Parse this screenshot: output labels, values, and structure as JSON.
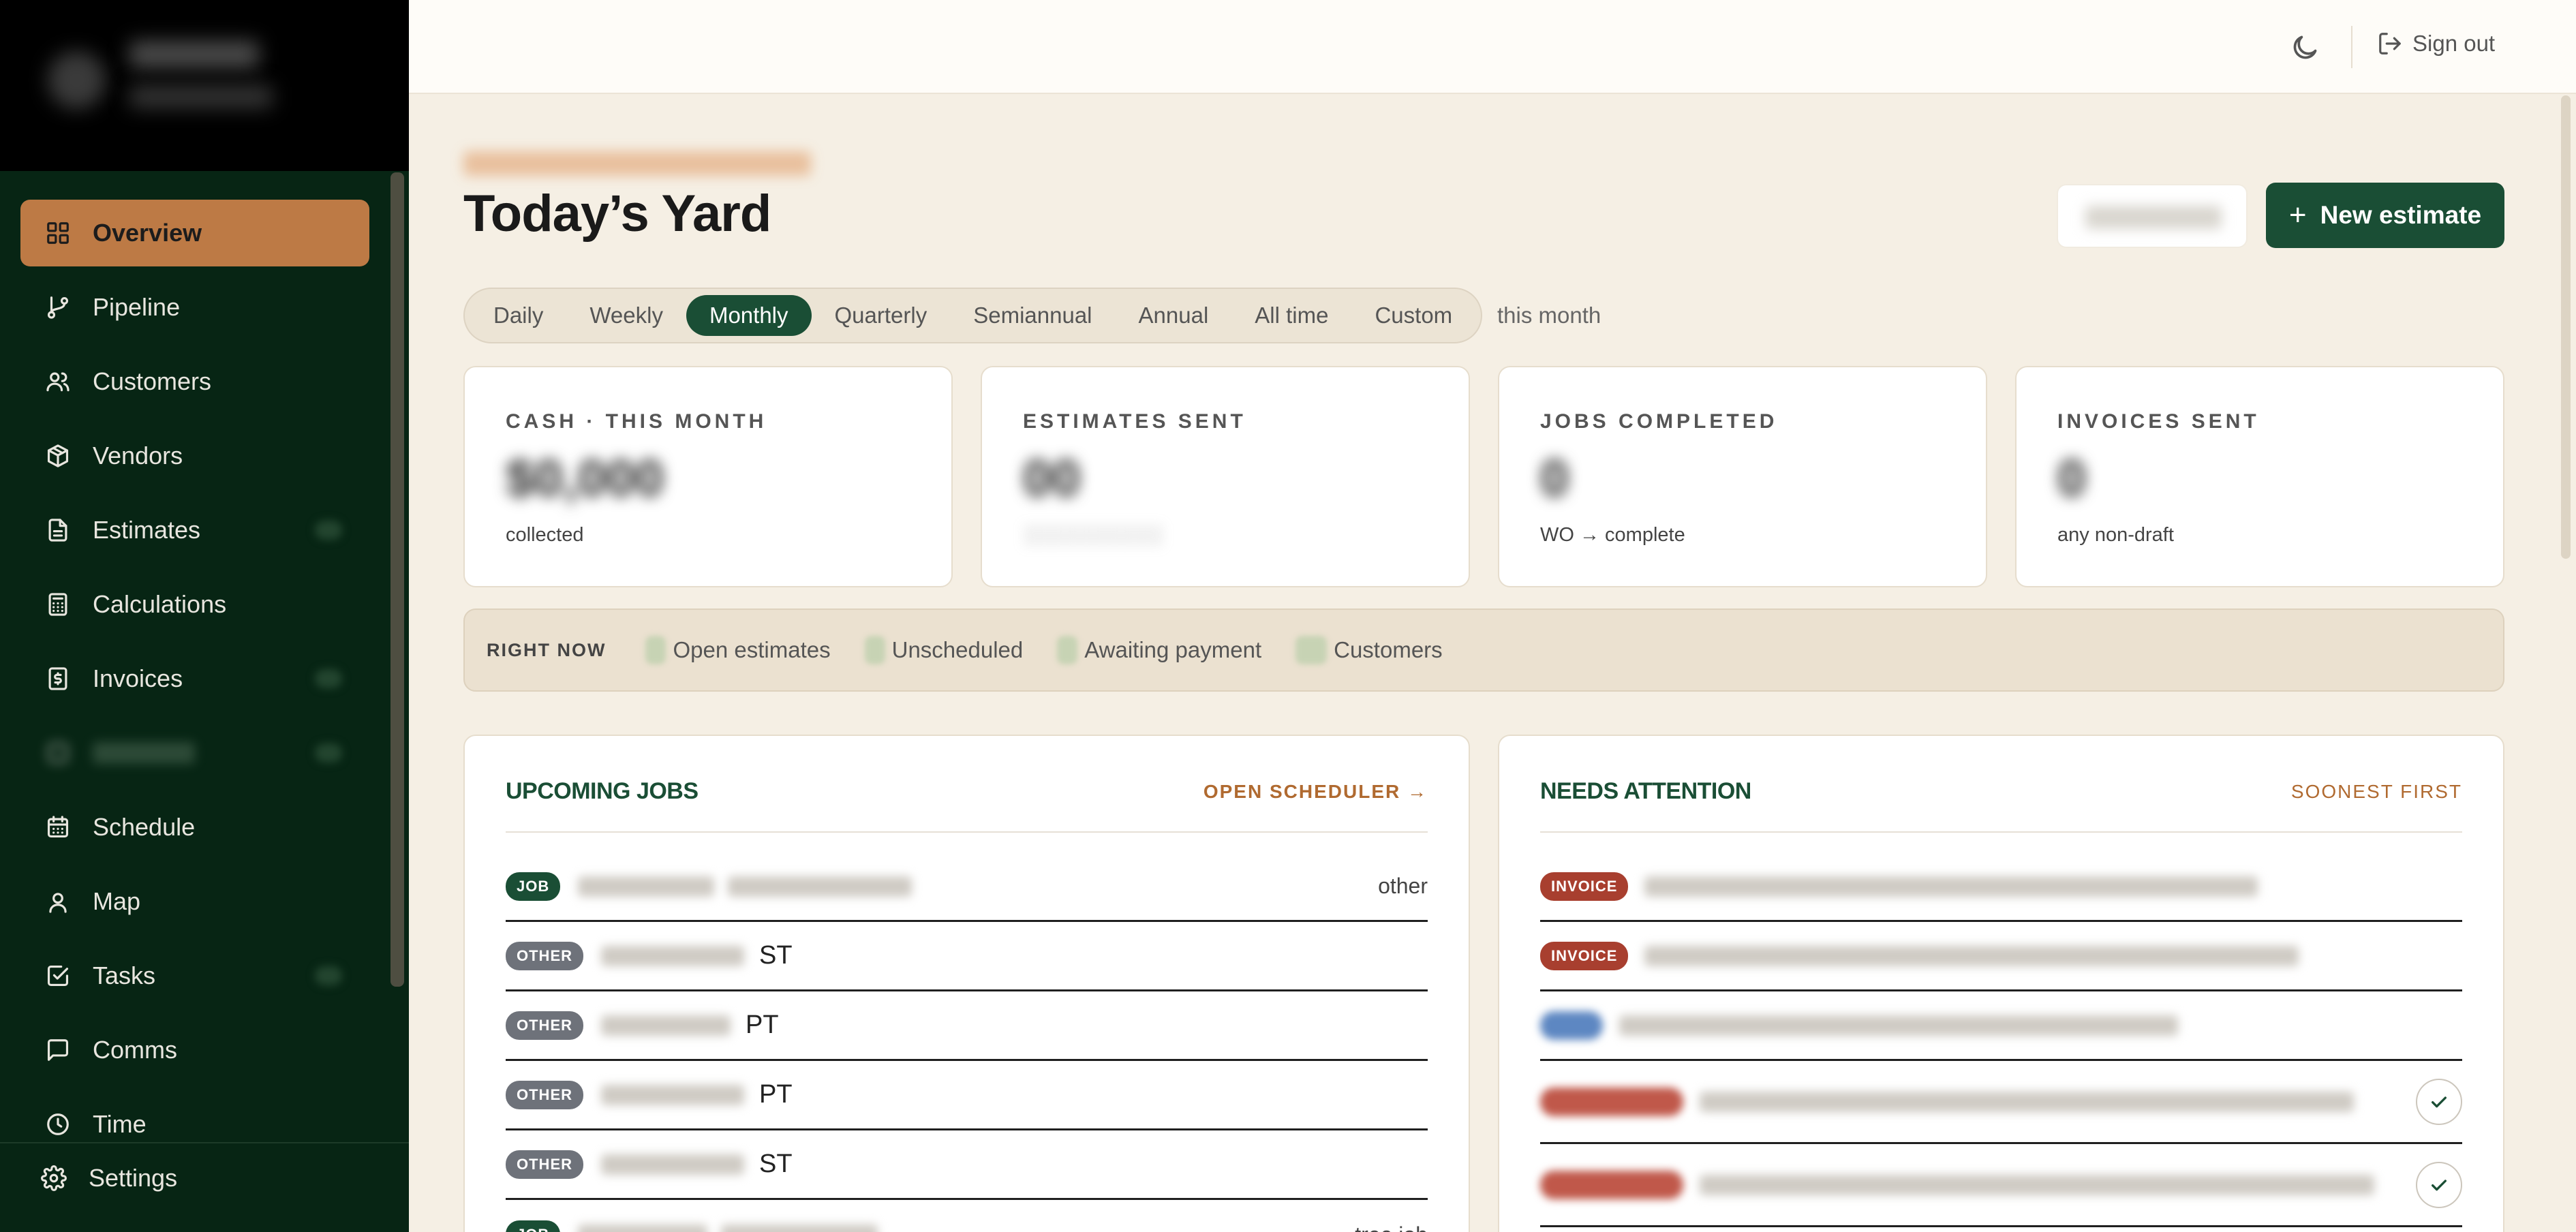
{
  "topbar": {
    "signout_label": "Sign out"
  },
  "sidebar": {
    "items": [
      {
        "label": "Overview",
        "icon": "grid-icon"
      },
      {
        "label": "Pipeline",
        "icon": "git-branch-icon"
      },
      {
        "label": "Customers",
        "icon": "users-icon"
      },
      {
        "label": "Vendors",
        "icon": "package-icon"
      },
      {
        "label": "Estimates",
        "icon": "file-text-icon"
      },
      {
        "label": "Calculations",
        "icon": "calculator-icon"
      },
      {
        "label": "Invoices",
        "icon": "dollar-receipt-icon"
      },
      {
        "label": "",
        "icon": "redacted-icon"
      },
      {
        "label": "Schedule",
        "icon": "calendar-icon"
      },
      {
        "label": "Map",
        "icon": "map-pin-icon"
      },
      {
        "label": "Tasks",
        "icon": "check-square-icon"
      },
      {
        "label": "Comms",
        "icon": "message-icon"
      },
      {
        "label": "Time",
        "icon": "clock-icon"
      }
    ],
    "settings_label": "Settings"
  },
  "header": {
    "title": "Today’s Yard",
    "new_estimate_label": "New estimate"
  },
  "period": {
    "tabs": [
      "Daily",
      "Weekly",
      "Monthly",
      "Quarterly",
      "Semiannual",
      "Annual",
      "All time",
      "Custom"
    ],
    "active": "Monthly",
    "note": "this month"
  },
  "kpis": [
    {
      "label": "CASH · THIS MONTH",
      "sub": "collected"
    },
    {
      "label": "ESTIMATES SENT",
      "sub": ""
    },
    {
      "label": "JOBS COMPLETED",
      "sub": "WO → complete"
    },
    {
      "label": "INVOICES SENT",
      "sub": "any non-draft"
    }
  ],
  "right_now": {
    "label": "RIGHT NOW",
    "items": [
      "Open estimates",
      "Unscheduled",
      "Awaiting payment",
      "Customers"
    ]
  },
  "upcoming": {
    "title": "UPCOMING JOBS",
    "link": "OPEN SCHEDULER →",
    "rows": [
      {
        "tag": "JOB",
        "text": "",
        "right": "other"
      },
      {
        "tag": "OTHER",
        "text": "ST",
        "right": ""
      },
      {
        "tag": "OTHER",
        "text": "PT",
        "right": ""
      },
      {
        "tag": "OTHER",
        "text": "PT",
        "right": ""
      },
      {
        "tag": "OTHER",
        "text": "ST",
        "right": ""
      },
      {
        "tag": "JOB",
        "text": "",
        "right": "tree job"
      }
    ]
  },
  "attention": {
    "title": "NEEDS ATTENTION",
    "link": "SOONEST FIRST",
    "rows": [
      {
        "tag": "INVOICE"
      },
      {
        "tag": "INVOICE"
      },
      {
        "tag": ""
      },
      {
        "tag": ""
      },
      {
        "tag": ""
      }
    ]
  }
}
